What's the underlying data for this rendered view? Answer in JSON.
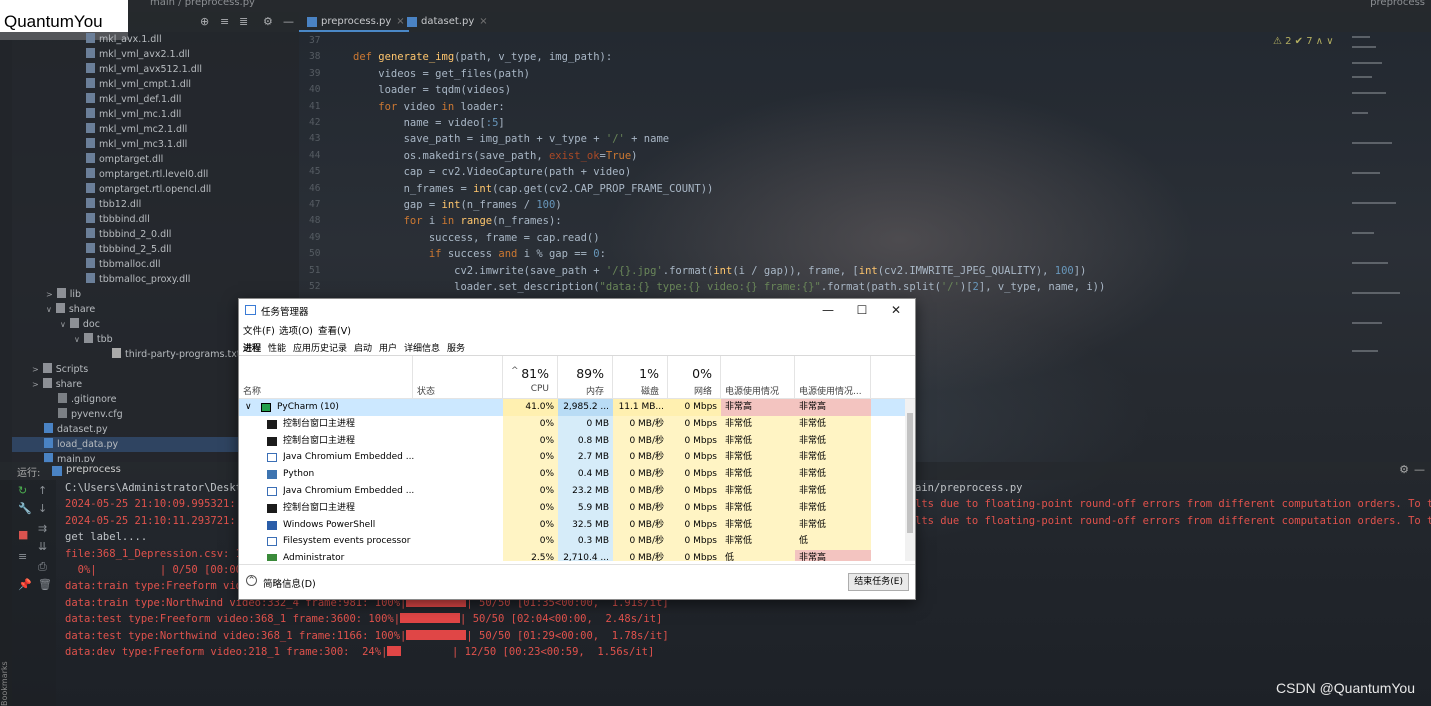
{
  "ide": {
    "breadcrumb": "main  /  preprocess.py",
    "run_config": "preprocess",
    "editor_tabs": [
      {
        "label": "preprocess.py",
        "active": true
      },
      {
        "label": "dataset.py",
        "active": false
      }
    ],
    "inspections": "⚠ 2  ✔ 7  ∧  ∨"
  },
  "logo": "QuantumYou",
  "project_toolbar": {
    "icons": [
      "⊕",
      "≡",
      "≣",
      "⚙",
      "—"
    ]
  },
  "project_tree": [
    {
      "label": "mkl_avx.1.dll",
      "type": "dll",
      "indent": 86
    },
    {
      "label": "mkl_vml_avx2.1.dll",
      "type": "dll",
      "indent": 86
    },
    {
      "label": "mkl_vml_avx512.1.dll",
      "type": "dll",
      "indent": 86
    },
    {
      "label": "mkl_vml_cmpt.1.dll",
      "type": "dll",
      "indent": 86
    },
    {
      "label": "mkl_vml_def.1.dll",
      "type": "dll",
      "indent": 86
    },
    {
      "label": "mkl_vml_mc.1.dll",
      "type": "dll",
      "indent": 86
    },
    {
      "label": "mkl_vml_mc2.1.dll",
      "type": "dll",
      "indent": 86
    },
    {
      "label": "mkl_vml_mc3.1.dll",
      "type": "dll",
      "indent": 86
    },
    {
      "label": "omptarget.dll",
      "type": "dll",
      "indent": 86
    },
    {
      "label": "omptarget.rtl.level0.dll",
      "type": "dll",
      "indent": 86
    },
    {
      "label": "omptarget.rtl.opencl.dll",
      "type": "dll",
      "indent": 86
    },
    {
      "label": "tbb12.dll",
      "type": "dll",
      "indent": 86
    },
    {
      "label": "tbbbind.dll",
      "type": "dll",
      "indent": 86
    },
    {
      "label": "tbbbind_2_0.dll",
      "type": "dll",
      "indent": 86
    },
    {
      "label": "tbbbind_2_5.dll",
      "type": "dll",
      "indent": 86
    },
    {
      "label": "tbbmalloc.dll",
      "type": "dll",
      "indent": 86
    },
    {
      "label": "tbbmalloc_proxy.dll",
      "type": "dll",
      "indent": 86
    },
    {
      "label": "lib",
      "type": "folder",
      "indent": 58,
      "arrow": ">"
    },
    {
      "label": "share",
      "type": "folder",
      "indent": 58,
      "arrow": "∨"
    },
    {
      "label": "doc",
      "type": "folder",
      "indent": 72,
      "arrow": "∨"
    },
    {
      "label": "tbb",
      "type": "folder",
      "indent": 86,
      "arrow": "∨"
    },
    {
      "label": "third-party-programs.txt",
      "type": "txt",
      "indent": 112
    },
    {
      "label": "Scripts",
      "type": "folder",
      "indent": 44,
      "arrow": ">"
    },
    {
      "label": "share",
      "type": "folder",
      "indent": 44,
      "arrow": ">"
    },
    {
      "label": ".gitignore",
      "type": "cfg",
      "indent": 58
    },
    {
      "label": "pyvenv.cfg",
      "type": "cfg",
      "indent": 58
    },
    {
      "label": "dataset.py",
      "type": "py",
      "indent": 44
    },
    {
      "label": "load_data.py",
      "type": "py",
      "indent": 44,
      "selected": true
    },
    {
      "label": "main.py",
      "type": "py",
      "indent": 44
    }
  ],
  "code": {
    "line_numbers": [
      "37",
      "38",
      "39",
      "40",
      "41",
      "42",
      "43",
      "44",
      "45",
      "46",
      "47",
      "48",
      "49",
      "50",
      "51",
      "52"
    ],
    "lines": [
      [],
      [
        {
          "t": "def ",
          "c": "kw"
        },
        {
          "t": "generate_img",
          "c": "fn"
        },
        {
          "t": "(path, v_type, img_path):"
        }
      ],
      [
        {
          "t": "    videos = get_files(path)"
        }
      ],
      [
        {
          "t": "    loader = tqdm(videos)"
        }
      ],
      [
        {
          "t": "    "
        },
        {
          "t": "for ",
          "c": "kw"
        },
        {
          "t": "video "
        },
        {
          "t": "in ",
          "c": "kw"
        },
        {
          "t": "loader:"
        }
      ],
      [
        {
          "t": "        name = video["
        },
        {
          "t": ":5",
          "c": "num"
        },
        {
          "t": "]"
        }
      ],
      [
        {
          "t": "        save_path = img_path + v_type + "
        },
        {
          "t": "'/'",
          "c": "str"
        },
        {
          "t": " + name"
        }
      ],
      [
        {
          "t": "        os.makedirs(save_path, "
        },
        {
          "t": "exist_ok",
          "c": "kwarg"
        },
        {
          "t": "="
        },
        {
          "t": "True",
          "c": "kw"
        },
        {
          "t": ")"
        }
      ],
      [
        {
          "t": "        cap = cv2.VideoCapture(path + video)"
        }
      ],
      [
        {
          "t": "        n_frames = "
        },
        {
          "t": "int",
          "c": "fn"
        },
        {
          "t": "(cap.get(cv2.CAP_PROP_FRAME_COUNT))"
        }
      ],
      [
        {
          "t": "        gap = "
        },
        {
          "t": "int",
          "c": "fn"
        },
        {
          "t": "(n_frames / "
        },
        {
          "t": "100",
          "c": "num"
        },
        {
          "t": ")"
        }
      ],
      [
        {
          "t": "        "
        },
        {
          "t": "for ",
          "c": "kw"
        },
        {
          "t": "i "
        },
        {
          "t": "in ",
          "c": "kw"
        },
        {
          "t": "range",
          "c": "fn"
        },
        {
          "t": "(n_frames):"
        }
      ],
      [
        {
          "t": "            success, frame = cap.read()"
        }
      ],
      [
        {
          "t": "            "
        },
        {
          "t": "if ",
          "c": "kw"
        },
        {
          "t": "success "
        },
        {
          "t": "and ",
          "c": "kw"
        },
        {
          "t": "i % gap == "
        },
        {
          "t": "0",
          "c": "num"
        },
        {
          "t": ":"
        }
      ],
      [
        {
          "t": "                cv2.imwrite(save_path + "
        },
        {
          "t": "'/{}.jpg'",
          "c": "str"
        },
        {
          "t": ".format("
        },
        {
          "t": "int",
          "c": "fn"
        },
        {
          "t": "(i / gap)), frame, ["
        },
        {
          "t": "int",
          "c": "fn"
        },
        {
          "t": "(cv2.IMWRITE_JPEG_QUALITY), "
        },
        {
          "t": "100",
          "c": "num"
        },
        {
          "t": "])"
        }
      ],
      [
        {
          "t": "                loader.set_description("
        },
        {
          "t": "\"data:{} type:{} video:{} frame:{}\"",
          "c": "str"
        },
        {
          "t": ".format(path.split("
        },
        {
          "t": "'/'",
          "c": "str"
        },
        {
          "t": ")["
        },
        {
          "t": "2",
          "c": "num"
        },
        {
          "t": "], v_type, name, i))"
        }
      ]
    ]
  },
  "run": {
    "label": "运行:",
    "tab": "preprocess",
    "lines": [
      {
        "t": "C:\\Users\\Administrator\\Desktop",
        "c": "gray",
        "suffix": "ain/preprocess.py",
        "suffix_c": "gray"
      },
      {
        "t": "2024-05-25 21:10:09.995321: I",
        "c": "red",
        "suffix": "lts due to floating-point round-off errors from different computation orders. To turn t",
        "suffix_c": "red"
      },
      {
        "t": "2024-05-25 21:10:11.293721: I",
        "c": "red",
        "suffix": "lts due to floating-point round-off errors from different computation orders. To turn t",
        "suffix_c": "red"
      },
      {
        "t": "get label....",
        "c": "gray"
      },
      {
        "t": "file:368_1_Depression.csv: 10",
        "c": "red"
      },
      {
        "t": "  0%|          | 0/50 [00:00<",
        "c": "red"
      },
      {
        "t": "data:train type:Freeform vide",
        "c": "red"
      },
      {
        "t": "data:train type:Northwind video:332_4 frame:981: 100%|",
        "c": "red",
        "bar": 60,
        "after": "| 50/50 [01:35<00:00,  1.91s/it]"
      },
      {
        "t": "data:test type:Freeform video:368_1 frame:3600: 100%|",
        "c": "red",
        "bar": 60,
        "after": "| 50/50 [02:04<00:00,  2.48s/it]"
      },
      {
        "t": "data:test type:Northwind video:368_1 frame:1166: 100%|",
        "c": "red",
        "bar": 60,
        "after": "| 50/50 [01:29<00:00,  1.78s/it]"
      },
      {
        "t": "data:dev type:Freeform video:218_1 frame:300:  24%|",
        "c": "red",
        "bar": 14,
        "after": "        | 12/50 [00:23<00:59,  1.56s/it]"
      }
    ]
  },
  "watermark": "CSDN @QuantumYou",
  "bookmarks": "Bookmarks",
  "task_manager": {
    "title": "任务管理器",
    "window_buttons": [
      "—",
      "☐",
      "✕"
    ],
    "menu": [
      "文件(F)",
      "选项(O)",
      "查看(V)"
    ],
    "tabs": [
      "进程",
      "性能",
      "应用历史记录",
      "启动",
      "用户",
      "详细信息",
      "服务"
    ],
    "headers": {
      "name": "名称",
      "status": "状态",
      "cpu_pct": "81%",
      "cpu": "CPU",
      "mem_pct": "89%",
      "mem": "内存",
      "disk_pct": "1%",
      "disk": "磁盘",
      "net_pct": "0%",
      "net": "网络",
      "power": "电源使用情况",
      "power_trend": "电源使用情况..."
    },
    "rows": [
      {
        "name": "PyCharm (10)",
        "icon": "pycharm",
        "group": true,
        "cpu": "41.0%",
        "mem": "2,985.2 ...",
        "disk": "11.1 MB...",
        "net": "0 Mbps",
        "power": "非常高",
        "trend": "非常高",
        "hot": true
      },
      {
        "name": "控制台窗口主进程",
        "icon": "console",
        "cpu": "0%",
        "mem": "0 MB",
        "disk": "0 MB/秒",
        "net": "0 Mbps",
        "power": "非常低",
        "trend": "非常低"
      },
      {
        "name": "控制台窗口主进程",
        "icon": "console",
        "cpu": "0%",
        "mem": "0.8 MB",
        "disk": "0 MB/秒",
        "net": "0 Mbps",
        "power": "非常低",
        "trend": "非常低"
      },
      {
        "name": "Java Chromium Embedded ...",
        "icon": "chromium",
        "cpu": "0%",
        "mem": "2.7 MB",
        "disk": "0 MB/秒",
        "net": "0 Mbps",
        "power": "非常低",
        "trend": "非常低"
      },
      {
        "name": "Python",
        "icon": "python",
        "cpu": "0%",
        "mem": "0.4 MB",
        "disk": "0 MB/秒",
        "net": "0 Mbps",
        "power": "非常低",
        "trend": "非常低"
      },
      {
        "name": "Java Chromium Embedded ...",
        "icon": "chromium",
        "cpu": "0%",
        "mem": "23.2 MB",
        "disk": "0 MB/秒",
        "net": "0 Mbps",
        "power": "非常低",
        "trend": "非常低"
      },
      {
        "name": "控制台窗口主进程",
        "icon": "console",
        "cpu": "0%",
        "mem": "5.9 MB",
        "disk": "0 MB/秒",
        "net": "0 Mbps",
        "power": "非常低",
        "trend": "非常低"
      },
      {
        "name": "Windows PowerShell",
        "icon": "ps",
        "cpu": "0%",
        "mem": "32.5 MB",
        "disk": "0 MB/秒",
        "net": "0 Mbps",
        "power": "非常低",
        "trend": "非常低"
      },
      {
        "name": "Filesystem events processor",
        "icon": "fs",
        "cpu": "0%",
        "mem": "0.3 MB",
        "disk": "0 MB/秒",
        "net": "0 Mbps",
        "power": "非常低",
        "trend": "低"
      },
      {
        "name": "Administrator",
        "icon": "admin",
        "cpu": "2.5%",
        "mem": "2,710.4 ...",
        "disk": "0 MB/秒",
        "net": "0 Mbps",
        "power": "低",
        "trend": "非常高",
        "hot_trend": true
      }
    ],
    "footer_less": "简略信息(D)",
    "footer_end": "结束任务(E)"
  }
}
